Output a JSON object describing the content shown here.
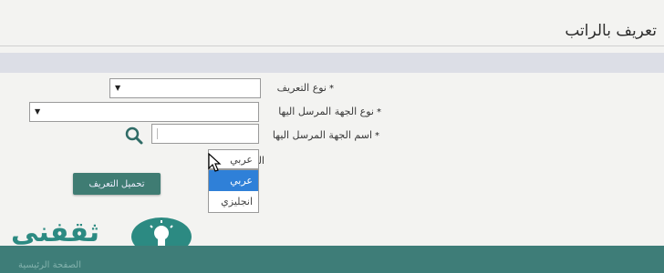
{
  "header": {
    "title": "تعريف بالراتب"
  },
  "form": {
    "required_mark": "*",
    "cert_type": {
      "label": "نوع التعريف"
    },
    "recipient_type": {
      "label": "نوع الجهة المرسل اليها"
    },
    "recipient_name": {
      "label": "اسم الجهة المرسل اليها"
    },
    "language": {
      "label": "اللغه",
      "selected_value": "عربي",
      "options": [
        "عربي",
        "انجليزي"
      ],
      "highlighted_index": 0
    },
    "download_button": "تحميل التعريف"
  },
  "logo": {
    "text": "ثقفني"
  },
  "footer": {
    "text": "الصفحة الرئيسية"
  },
  "colors": {
    "accent": "#3f7c73",
    "highlight": "#2f80d8",
    "band": "#dcdee6",
    "logo": "#2c8a82"
  },
  "icons": [
    "search-icon",
    "dropdown-arrow-icon",
    "mouse-cursor-icon",
    "lightbulb-icon"
  ]
}
